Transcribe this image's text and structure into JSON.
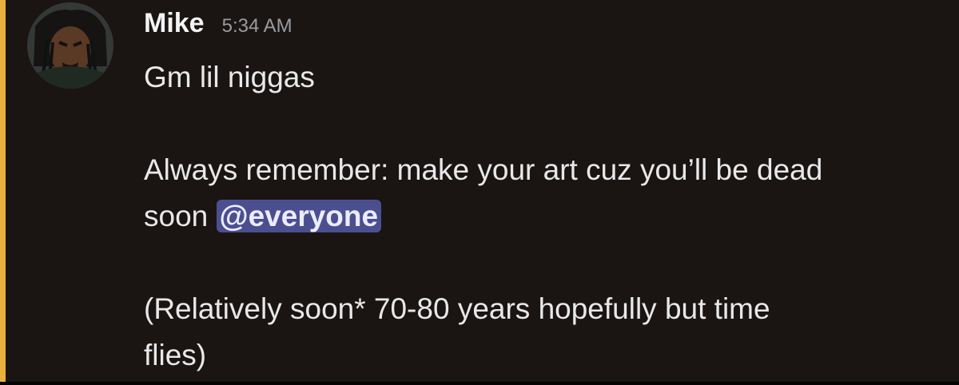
{
  "message": {
    "author": "Mike",
    "timestamp": "5:34 AM",
    "lines": {
      "l1": "Gm lil niggas",
      "l2": "Always remember: make your art cuz you’ll be dead",
      "l3_text": "soon ",
      "l3_mention": "@everyone",
      "l4": "(Relatively soon* 70-80 years hopefully but time",
      "l5": "flies)"
    }
  },
  "colors": {
    "background": "#1a1512",
    "highlight_bar": "#e8b13e",
    "mention_bg": "#4b4f90"
  }
}
